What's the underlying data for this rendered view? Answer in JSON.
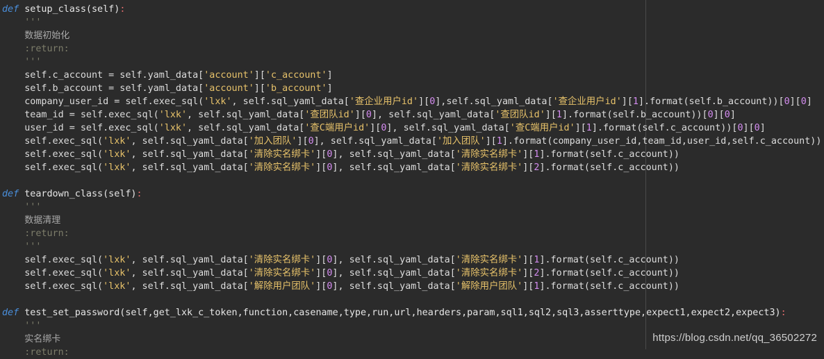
{
  "lines": [
    [
      {
        "t": "def",
        "c": "kw"
      },
      {
        "t": " setup_class(self)",
        "c": "fn"
      },
      {
        "t": ":",
        "c": "punc-colon"
      }
    ],
    [
      {
        "t": "    '''",
        "c": "doc"
      }
    ],
    [
      {
        "t": "    ",
        "c": "doc"
      },
      {
        "t": "数据初始化",
        "c": "doccn"
      }
    ],
    [
      {
        "t": "    :return:",
        "c": "doc"
      }
    ],
    [
      {
        "t": "    '''",
        "c": "doc"
      }
    ],
    [
      {
        "t": "    self.c_account = self.yaml_data[",
        "c": "plain"
      },
      {
        "t": "'account'",
        "c": "str"
      },
      {
        "t": "][",
        "c": "plain"
      },
      {
        "t": "'c_account'",
        "c": "str"
      },
      {
        "t": "]",
        "c": "plain"
      }
    ],
    [
      {
        "t": "    self.b_account = self.yaml_data[",
        "c": "plain"
      },
      {
        "t": "'account'",
        "c": "str"
      },
      {
        "t": "][",
        "c": "plain"
      },
      {
        "t": "'b_account'",
        "c": "str"
      },
      {
        "t": "]",
        "c": "plain"
      }
    ],
    [
      {
        "t": "    company_user_id = self.exec_sql(",
        "c": "plain"
      },
      {
        "t": "'lxk'",
        "c": "str"
      },
      {
        "t": ", self.sql_yaml_data[",
        "c": "plain"
      },
      {
        "t": "'查企业用户id'",
        "c": "str"
      },
      {
        "t": "][",
        "c": "plain"
      },
      {
        "t": "0",
        "c": "num"
      },
      {
        "t": "],self.sql_yaml_data[",
        "c": "plain"
      },
      {
        "t": "'查企业用户id'",
        "c": "str"
      },
      {
        "t": "][",
        "c": "plain"
      },
      {
        "t": "1",
        "c": "num"
      },
      {
        "t": "].format(self.b_account))[",
        "c": "plain"
      },
      {
        "t": "0",
        "c": "num"
      },
      {
        "t": "][",
        "c": "plain"
      },
      {
        "t": "0",
        "c": "num"
      },
      {
        "t": "]",
        "c": "plain"
      }
    ],
    [
      {
        "t": "    team_id = self.exec_sql(",
        "c": "plain"
      },
      {
        "t": "'lxk'",
        "c": "str"
      },
      {
        "t": ", self.sql_yaml_data[",
        "c": "plain"
      },
      {
        "t": "'查团队id'",
        "c": "str"
      },
      {
        "t": "][",
        "c": "plain"
      },
      {
        "t": "0",
        "c": "num"
      },
      {
        "t": "], self.sql_yaml_data[",
        "c": "plain"
      },
      {
        "t": "'查团队id'",
        "c": "str"
      },
      {
        "t": "][",
        "c": "plain"
      },
      {
        "t": "1",
        "c": "num"
      },
      {
        "t": "].format(self.b_account))[",
        "c": "plain"
      },
      {
        "t": "0",
        "c": "num"
      },
      {
        "t": "][",
        "c": "plain"
      },
      {
        "t": "0",
        "c": "num"
      },
      {
        "t": "]",
        "c": "plain"
      }
    ],
    [
      {
        "t": "    user_id = self.exec_sql(",
        "c": "plain"
      },
      {
        "t": "'lxk'",
        "c": "str"
      },
      {
        "t": ", self.sql_yaml_data[",
        "c": "plain"
      },
      {
        "t": "'查C端用户id'",
        "c": "str"
      },
      {
        "t": "][",
        "c": "plain"
      },
      {
        "t": "0",
        "c": "num"
      },
      {
        "t": "], self.sql_yaml_data[",
        "c": "plain"
      },
      {
        "t": "'查C端用户id'",
        "c": "str"
      },
      {
        "t": "][",
        "c": "plain"
      },
      {
        "t": "1",
        "c": "num"
      },
      {
        "t": "].format(self.c_account))[",
        "c": "plain"
      },
      {
        "t": "0",
        "c": "num"
      },
      {
        "t": "][",
        "c": "plain"
      },
      {
        "t": "0",
        "c": "num"
      },
      {
        "t": "]",
        "c": "plain"
      }
    ],
    [
      {
        "t": "    self.exec_sql(",
        "c": "plain"
      },
      {
        "t": "'lxk'",
        "c": "str"
      },
      {
        "t": ", self.sql_yaml_data[",
        "c": "plain"
      },
      {
        "t": "'加入团队'",
        "c": "str"
      },
      {
        "t": "][",
        "c": "plain"
      },
      {
        "t": "0",
        "c": "num"
      },
      {
        "t": "], self.sql_yaml_data[",
        "c": "plain"
      },
      {
        "t": "'加入团队'",
        "c": "str"
      },
      {
        "t": "][",
        "c": "plain"
      },
      {
        "t": "1",
        "c": "num"
      },
      {
        "t": "].format(company_user_id,team_id,user_id,self.c_account))",
        "c": "plain"
      }
    ],
    [
      {
        "t": "    self.exec_sql(",
        "c": "plain"
      },
      {
        "t": "'lxk'",
        "c": "str"
      },
      {
        "t": ", self.sql_yaml_data[",
        "c": "plain"
      },
      {
        "t": "'清除实名绑卡'",
        "c": "str"
      },
      {
        "t": "][",
        "c": "plain"
      },
      {
        "t": "0",
        "c": "num"
      },
      {
        "t": "], self.sql_yaml_data[",
        "c": "plain"
      },
      {
        "t": "'清除实名绑卡'",
        "c": "str"
      },
      {
        "t": "][",
        "c": "plain"
      },
      {
        "t": "1",
        "c": "num"
      },
      {
        "t": "].format(self.c_account))",
        "c": "plain"
      }
    ],
    [
      {
        "t": "    self.exec_sql(",
        "c": "plain"
      },
      {
        "t": "'lxk'",
        "c": "str"
      },
      {
        "t": ", self.sql_yaml_data[",
        "c": "plain"
      },
      {
        "t": "'清除实名绑卡'",
        "c": "str"
      },
      {
        "t": "][",
        "c": "plain"
      },
      {
        "t": "0",
        "c": "num"
      },
      {
        "t": "], self.sql_yaml_data[",
        "c": "plain"
      },
      {
        "t": "'清除实名绑卡'",
        "c": "str"
      },
      {
        "t": "][",
        "c": "plain"
      },
      {
        "t": "2",
        "c": "num"
      },
      {
        "t": "].format(self.c_account))",
        "c": "plain"
      }
    ],
    [],
    [
      {
        "t": "def",
        "c": "kw"
      },
      {
        "t": " teardown_class(self)",
        "c": "fn"
      },
      {
        "t": ":",
        "c": "punc-colon"
      }
    ],
    [
      {
        "t": "    '''",
        "c": "doc"
      }
    ],
    [
      {
        "t": "    ",
        "c": "doc"
      },
      {
        "t": "数据清理",
        "c": "doccn"
      }
    ],
    [
      {
        "t": "    :return:",
        "c": "doc"
      }
    ],
    [
      {
        "t": "    '''",
        "c": "doc"
      }
    ],
    [
      {
        "t": "    self.exec_sql(",
        "c": "plain"
      },
      {
        "t": "'lxk'",
        "c": "str"
      },
      {
        "t": ", self.sql_yaml_data[",
        "c": "plain"
      },
      {
        "t": "'清除实名绑卡'",
        "c": "str"
      },
      {
        "t": "][",
        "c": "plain"
      },
      {
        "t": "0",
        "c": "num"
      },
      {
        "t": "], self.sql_yaml_data[",
        "c": "plain"
      },
      {
        "t": "'清除实名绑卡'",
        "c": "str"
      },
      {
        "t": "][",
        "c": "plain"
      },
      {
        "t": "1",
        "c": "num"
      },
      {
        "t": "].format(self.c_account))",
        "c": "plain"
      }
    ],
    [
      {
        "t": "    self.exec_sql(",
        "c": "plain"
      },
      {
        "t": "'lxk'",
        "c": "str"
      },
      {
        "t": ", self.sql_yaml_data[",
        "c": "plain"
      },
      {
        "t": "'清除实名绑卡'",
        "c": "str"
      },
      {
        "t": "][",
        "c": "plain"
      },
      {
        "t": "0",
        "c": "num"
      },
      {
        "t": "], self.sql_yaml_data[",
        "c": "plain"
      },
      {
        "t": "'清除实名绑卡'",
        "c": "str"
      },
      {
        "t": "][",
        "c": "plain"
      },
      {
        "t": "2",
        "c": "num"
      },
      {
        "t": "].format(self.c_account))",
        "c": "plain"
      }
    ],
    [
      {
        "t": "    self.exec_sql(",
        "c": "plain"
      },
      {
        "t": "'lxk'",
        "c": "str"
      },
      {
        "t": ", self.sql_yaml_data[",
        "c": "plain"
      },
      {
        "t": "'解除用户团队'",
        "c": "str"
      },
      {
        "t": "][",
        "c": "plain"
      },
      {
        "t": "0",
        "c": "num"
      },
      {
        "t": "], self.sql_yaml_data[",
        "c": "plain"
      },
      {
        "t": "'解除用户团队'",
        "c": "str"
      },
      {
        "t": "][",
        "c": "plain"
      },
      {
        "t": "1",
        "c": "num"
      },
      {
        "t": "].format(self.c_account))",
        "c": "plain"
      }
    ],
    [],
    [
      {
        "t": "def",
        "c": "kw"
      },
      {
        "t": " test_set_password(self,get_lxk_c_token,function,casename,type,run,url,hearders,param,sql1,sql2,sql3,asserttype,expect1,expect2,expect3)",
        "c": "fn"
      },
      {
        "t": ":",
        "c": "punc-colon"
      }
    ],
    [
      {
        "t": "    '''",
        "c": "doc"
      }
    ],
    [
      {
        "t": "    ",
        "c": "doc"
      },
      {
        "t": "实名绑卡",
        "c": "doccn"
      }
    ],
    [
      {
        "t": "    :return:",
        "c": "doc"
      }
    ]
  ],
  "watermark": "https://blog.csdn.net/qq_36502272"
}
